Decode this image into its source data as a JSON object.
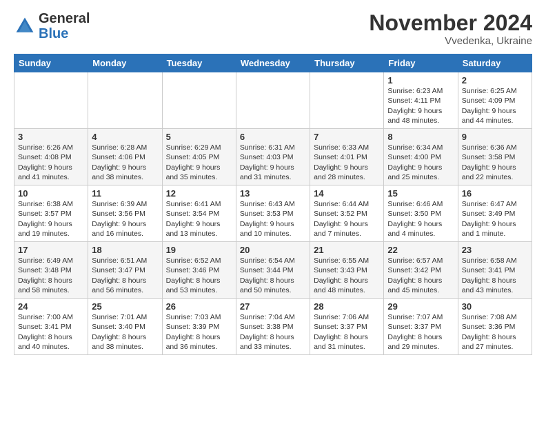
{
  "header": {
    "logo_general": "General",
    "logo_blue": "Blue",
    "month_title": "November 2024",
    "location": "Vvedenka, Ukraine"
  },
  "weekdays": [
    "Sunday",
    "Monday",
    "Tuesday",
    "Wednesday",
    "Thursday",
    "Friday",
    "Saturday"
  ],
  "weeks": [
    [
      {
        "day": "",
        "info": ""
      },
      {
        "day": "",
        "info": ""
      },
      {
        "day": "",
        "info": ""
      },
      {
        "day": "",
        "info": ""
      },
      {
        "day": "",
        "info": ""
      },
      {
        "day": "1",
        "info": "Sunrise: 6:23 AM\nSunset: 4:11 PM\nDaylight: 9 hours\nand 48 minutes."
      },
      {
        "day": "2",
        "info": "Sunrise: 6:25 AM\nSunset: 4:09 PM\nDaylight: 9 hours\nand 44 minutes."
      }
    ],
    [
      {
        "day": "3",
        "info": "Sunrise: 6:26 AM\nSunset: 4:08 PM\nDaylight: 9 hours\nand 41 minutes."
      },
      {
        "day": "4",
        "info": "Sunrise: 6:28 AM\nSunset: 4:06 PM\nDaylight: 9 hours\nand 38 minutes."
      },
      {
        "day": "5",
        "info": "Sunrise: 6:29 AM\nSunset: 4:05 PM\nDaylight: 9 hours\nand 35 minutes."
      },
      {
        "day": "6",
        "info": "Sunrise: 6:31 AM\nSunset: 4:03 PM\nDaylight: 9 hours\nand 31 minutes."
      },
      {
        "day": "7",
        "info": "Sunrise: 6:33 AM\nSunset: 4:01 PM\nDaylight: 9 hours\nand 28 minutes."
      },
      {
        "day": "8",
        "info": "Sunrise: 6:34 AM\nSunset: 4:00 PM\nDaylight: 9 hours\nand 25 minutes."
      },
      {
        "day": "9",
        "info": "Sunrise: 6:36 AM\nSunset: 3:58 PM\nDaylight: 9 hours\nand 22 minutes."
      }
    ],
    [
      {
        "day": "10",
        "info": "Sunrise: 6:38 AM\nSunset: 3:57 PM\nDaylight: 9 hours\nand 19 minutes."
      },
      {
        "day": "11",
        "info": "Sunrise: 6:39 AM\nSunset: 3:56 PM\nDaylight: 9 hours\nand 16 minutes."
      },
      {
        "day": "12",
        "info": "Sunrise: 6:41 AM\nSunset: 3:54 PM\nDaylight: 9 hours\nand 13 minutes."
      },
      {
        "day": "13",
        "info": "Sunrise: 6:43 AM\nSunset: 3:53 PM\nDaylight: 9 hours\nand 10 minutes."
      },
      {
        "day": "14",
        "info": "Sunrise: 6:44 AM\nSunset: 3:52 PM\nDaylight: 9 hours\nand 7 minutes."
      },
      {
        "day": "15",
        "info": "Sunrise: 6:46 AM\nSunset: 3:50 PM\nDaylight: 9 hours\nand 4 minutes."
      },
      {
        "day": "16",
        "info": "Sunrise: 6:47 AM\nSunset: 3:49 PM\nDaylight: 9 hours\nand 1 minute."
      }
    ],
    [
      {
        "day": "17",
        "info": "Sunrise: 6:49 AM\nSunset: 3:48 PM\nDaylight: 8 hours\nand 58 minutes."
      },
      {
        "day": "18",
        "info": "Sunrise: 6:51 AM\nSunset: 3:47 PM\nDaylight: 8 hours\nand 56 minutes."
      },
      {
        "day": "19",
        "info": "Sunrise: 6:52 AM\nSunset: 3:46 PM\nDaylight: 8 hours\nand 53 minutes."
      },
      {
        "day": "20",
        "info": "Sunrise: 6:54 AM\nSunset: 3:44 PM\nDaylight: 8 hours\nand 50 minutes."
      },
      {
        "day": "21",
        "info": "Sunrise: 6:55 AM\nSunset: 3:43 PM\nDaylight: 8 hours\nand 48 minutes."
      },
      {
        "day": "22",
        "info": "Sunrise: 6:57 AM\nSunset: 3:42 PM\nDaylight: 8 hours\nand 45 minutes."
      },
      {
        "day": "23",
        "info": "Sunrise: 6:58 AM\nSunset: 3:41 PM\nDaylight: 8 hours\nand 43 minutes."
      }
    ],
    [
      {
        "day": "24",
        "info": "Sunrise: 7:00 AM\nSunset: 3:41 PM\nDaylight: 8 hours\nand 40 minutes."
      },
      {
        "day": "25",
        "info": "Sunrise: 7:01 AM\nSunset: 3:40 PM\nDaylight: 8 hours\nand 38 minutes."
      },
      {
        "day": "26",
        "info": "Sunrise: 7:03 AM\nSunset: 3:39 PM\nDaylight: 8 hours\nand 36 minutes."
      },
      {
        "day": "27",
        "info": "Sunrise: 7:04 AM\nSunset: 3:38 PM\nDaylight: 8 hours\nand 33 minutes."
      },
      {
        "day": "28",
        "info": "Sunrise: 7:06 AM\nSunset: 3:37 PM\nDaylight: 8 hours\nand 31 minutes."
      },
      {
        "day": "29",
        "info": "Sunrise: 7:07 AM\nSunset: 3:37 PM\nDaylight: 8 hours\nand 29 minutes."
      },
      {
        "day": "30",
        "info": "Sunrise: 7:08 AM\nSunset: 3:36 PM\nDaylight: 8 hours\nand 27 minutes."
      }
    ]
  ]
}
